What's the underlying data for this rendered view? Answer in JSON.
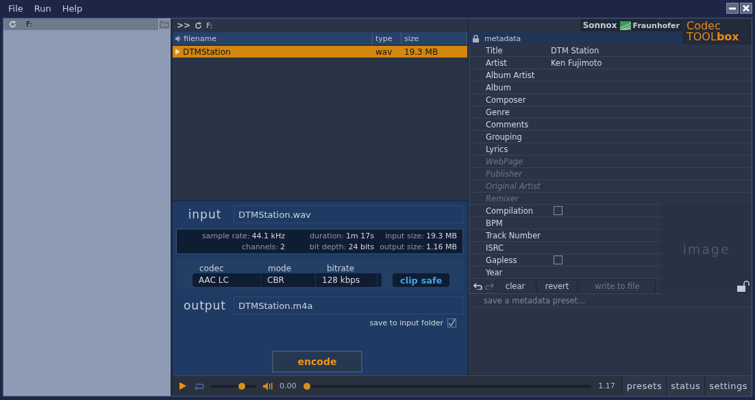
{
  "menu": [
    "File",
    "Run",
    "Help"
  ],
  "browser": {
    "path": "F:"
  },
  "files": {
    "nav": ">>",
    "path": "F:",
    "columns": [
      "filename",
      "type",
      "size"
    ],
    "rows": [
      {
        "filename": "DTMStation",
        "type": "wav",
        "size": "19.3 MB",
        "selected": true
      }
    ]
  },
  "logos": {
    "sonnox": "Sonnox",
    "fraunhofer": "Fraunhofer",
    "codec": "Codec",
    "tool": "TOOL",
    "box": "box"
  },
  "metadata": {
    "title": "metadata",
    "fields": [
      {
        "kind": "text",
        "label": "Title",
        "value": "DTM Station",
        "disabled": false
      },
      {
        "kind": "text",
        "label": "Artist",
        "value": "Ken Fujimoto",
        "disabled": false
      },
      {
        "kind": "text",
        "label": "Album Artist",
        "disabled": false
      },
      {
        "kind": "text",
        "label": "Album",
        "disabled": false
      },
      {
        "kind": "text",
        "label": "Composer",
        "disabled": false
      },
      {
        "kind": "text",
        "label": "Genre",
        "disabled": false
      },
      {
        "kind": "text",
        "label": "Comments",
        "disabled": false
      },
      {
        "kind": "text",
        "label": "Grouping",
        "disabled": false
      },
      {
        "kind": "text",
        "label": "Lyrics",
        "disabled": false
      },
      {
        "kind": "text",
        "label": "WebPage",
        "disabled": true
      },
      {
        "kind": "text",
        "label": "Publisher",
        "disabled": true
      },
      {
        "kind": "text",
        "label": "Original Artist",
        "disabled": true
      },
      {
        "kind": "text",
        "label": "Remixer",
        "disabled": true
      },
      {
        "kind": "checkbox",
        "label": "Compilation",
        "checked": false,
        "disabled": false
      },
      {
        "kind": "text",
        "label": "BPM",
        "disabled": false
      },
      {
        "kind": "text",
        "label": "Track Number",
        "disabled": false
      },
      {
        "kind": "text",
        "label": "ISRC",
        "disabled": false
      },
      {
        "kind": "checkbox",
        "label": "Gapless",
        "checked": false,
        "disabled": false
      },
      {
        "kind": "text",
        "label": "Year",
        "disabled": false
      }
    ],
    "buttons": [
      {
        "label": "clear",
        "disabled": false
      },
      {
        "label": "revert",
        "disabled": false
      },
      {
        "label": "write to file",
        "disabled": true
      }
    ],
    "image_placeholder": "image",
    "preset_placeholder": "save a metadata preset..."
  },
  "encoder": {
    "input_label": "input",
    "input_file": "DTMStation.wav",
    "info": [
      {
        "label": "sample rate:",
        "value": "44.1 kHz"
      },
      {
        "label": "duration:",
        "value": "1m 17s"
      },
      {
        "label": "input size:",
        "value": "19.3 MB"
      },
      {
        "label": "channels:",
        "value": "2"
      },
      {
        "label": "bit depth:",
        "value": "24 bits"
      },
      {
        "label": "output size:",
        "value": "1.16 MB"
      }
    ],
    "settings": [
      {
        "label": "codec",
        "value": "AAC LC"
      },
      {
        "label": "mode",
        "value": "CBR"
      },
      {
        "label": "bitrate",
        "value": "128 kbps"
      }
    ],
    "clip_safe": "clip safe",
    "output_label": "output",
    "output_file": "DTMStation.m4a",
    "save_to_input_folder": {
      "label": "save to input folder",
      "checked": true
    },
    "encode_button": "encode"
  },
  "transport": {
    "volume": {
      "level": 0.68
    },
    "time": "0.00",
    "position": {
      "level": 0
    },
    "duration": "1.17"
  },
  "bottom_tabs": [
    "presets",
    "status",
    "settings"
  ]
}
